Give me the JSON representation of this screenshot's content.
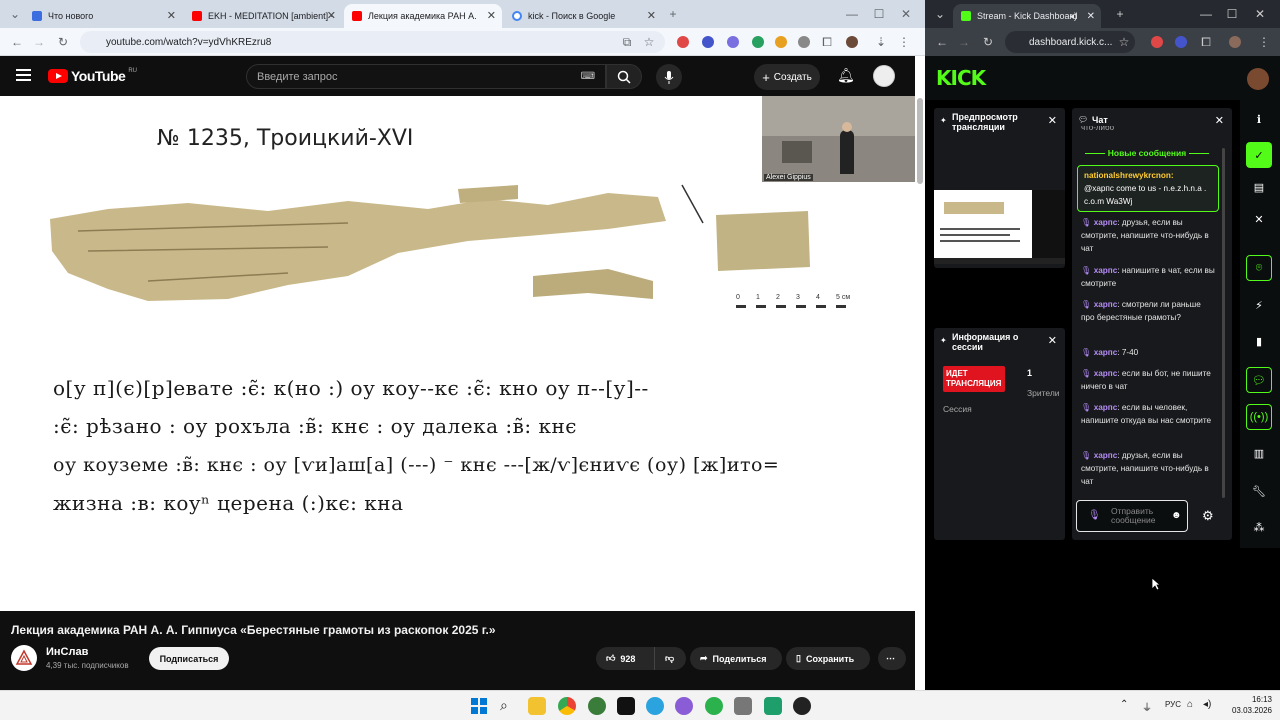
{
  "left_browser": {
    "tabs": [
      {
        "label": "Что нового",
        "color": "#3c6ee0"
      },
      {
        "label": "EKH - MEDITATION [ambient] -",
        "color": "#ff0000"
      },
      {
        "label": "Лекция академика РАН А.",
        "color": "#ff0000"
      },
      {
        "label": "kick - Поиск в Google",
        "color": "#4285f4"
      }
    ],
    "url": "youtube.com/watch?v=ydVhKREzru8"
  },
  "youtube": {
    "logo": "YouTube",
    "region": "RU",
    "search_placeholder": "Введите запрос",
    "create_label": "Создать",
    "video_title": "Лекция академика РАН А. А. Гиппиуса «Берестяные грамоты из раскопок 2025 г.»",
    "channel_name": "ИнСлав",
    "channel_subs": "4,39 тыс. подписчиков",
    "subscribe_label": "Подписаться",
    "likes": "928",
    "share_label": "Поделиться",
    "save_label": "Сохранить",
    "slide": {
      "title": "№ 1235, Троицкий-XVI",
      "lines": [
        "о[у п](є)[р]евате :є̃: к(но :) оу коу--кє :є̃: кно  оу п--[у]--",
        ":є̃: рѣзано : оу рохъла :в̃: кнє : оу далека :в̃: кнє",
        "оу коуземе :в̃: кнє : оу [ѵи]аш[а] (---) ⁻ кнє ---[ж/ѵ]єниѵє (оу) [ж]ито=",
        "жизна :в: коуⁿ церена (:)кє: кна"
      ],
      "scale_labels": [
        "0",
        "1",
        "2",
        "3",
        "4",
        "5 см"
      ],
      "webcam_name": "Alexei Gippius"
    }
  },
  "right_browser": {
    "tab_label": "Stream - Kick Dashboard",
    "url": "dashboard.kick.c...",
    "kick_logo": "KICK",
    "preview_title": "Предпросмотр трансляции",
    "session_title": "Информация о сессии",
    "live_badge": "ИДЕТ ТРАНСЛЯЦИЯ",
    "viewers_count": "1",
    "viewers_label": "Зрители",
    "session_label": "Сессия",
    "chat_title": "Чат",
    "chat_top_fragment": "что-либо",
    "new_messages_label": "Новые сообщения",
    "chat_messages": [
      {
        "user": "nationalshrewykrcnon:",
        "text": "@харпс come to us - n.e.z.h.n.a . c.o.m Wa3Wj",
        "highlight": true
      },
      {
        "user": "харпс",
        "text": ": друзья, если вы смотрите, напишите что-нибудь в чат"
      },
      {
        "user": "харпс",
        "text": ": напишите в чат, если вы смотрите"
      },
      {
        "user": "харпс",
        "text": ": смотрели ли раньше про берестяные грамоты?"
      },
      {
        "user": "харпс",
        "text": ": 7-40"
      },
      {
        "user": "харпс",
        "text": ": если вы бот, не пишите ничего в чат"
      },
      {
        "user": "харпс",
        "text": ": если вы человек, напишите откуда вы нас смотрите"
      },
      {
        "user": "харпс",
        "text": ": друзья, если вы смотрите, напишите что-нибудь в чат"
      }
    ],
    "send_placeholder": "Отправить сообщение"
  },
  "taskbar": {
    "lang": "РУС",
    "time": "16:13",
    "date": "03.03.2026"
  },
  "colors": {
    "kick_green": "#53fc18",
    "youtube_red": "#ff0000",
    "live_red": "#e0141e"
  }
}
